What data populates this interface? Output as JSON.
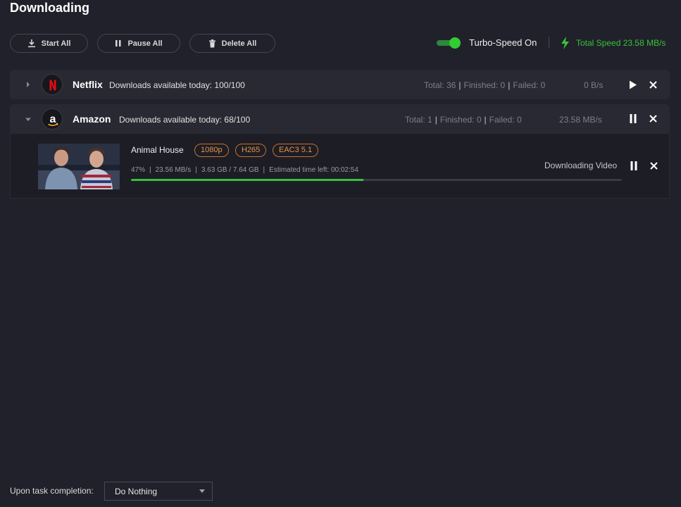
{
  "page": {
    "title": "Downloading"
  },
  "toolbar": {
    "start_all": "Start All",
    "pause_all": "Pause All",
    "delete_all": "Delete All",
    "turbo_label": "Turbo-Speed On",
    "turbo_on": true,
    "total_speed": "Total Speed 23.58 MB/s"
  },
  "groups": [
    {
      "name": "Netflix",
      "logo_letter": "N",
      "quota": "Downloads available today: 100/100",
      "total": "Total: 36",
      "finished": "Finished: 0",
      "failed": "Failed: 0",
      "speed": "0 B/s",
      "expanded": false,
      "action_icon": "play-icon"
    },
    {
      "name": "Amazon",
      "logo_letter": "a",
      "quota": "Downloads available today: 68/100",
      "total": "Total: 1",
      "finished": "Finished: 0",
      "failed": "Failed: 0",
      "speed": "23.58 MB/s",
      "expanded": true,
      "action_icon": "pause-icon"
    }
  ],
  "task": {
    "title": "Animal House",
    "badges": [
      "1080p",
      "H265",
      "EAC3 5.1"
    ],
    "percent": "47%",
    "speed": "23.56 MB/s",
    "size": "3.63 GB / 7.64 GB",
    "eta": "Estimated time left: 00:02:54",
    "progress_fraction": 0.474,
    "status": "Downloading Video"
  },
  "footer": {
    "completion_label": "Upon task completion:",
    "completion_value": "Do Nothing"
  },
  "colors": {
    "accent_green": "#35c535",
    "badge_orange": "#e7933f",
    "netflix_red": "#e50914"
  }
}
